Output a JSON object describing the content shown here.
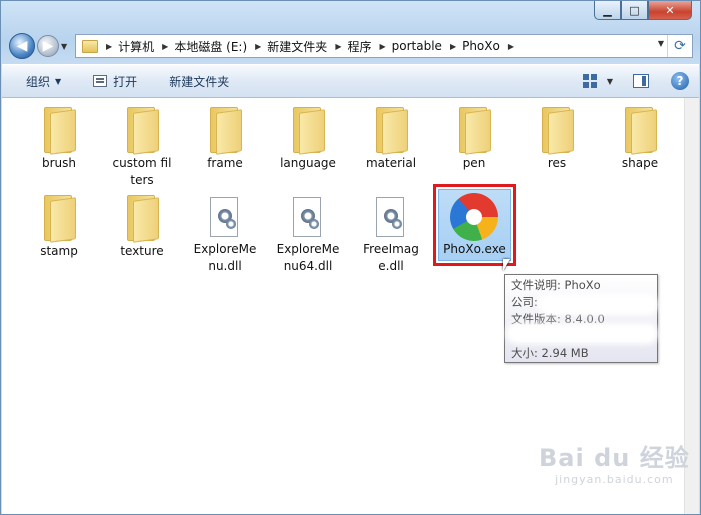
{
  "window": {
    "caption_buttons": [
      {
        "name": "minimize",
        "glyph": "▁"
      },
      {
        "name": "maximize",
        "glyph": "□"
      },
      {
        "name": "close",
        "glyph": "✕"
      }
    ]
  },
  "nav": {
    "back_glyph": "◀",
    "forward_glyph": "▶",
    "history_glyph": "▼"
  },
  "address": {
    "crumbs": [
      "计算机",
      "本地磁盘 (E:)",
      "新建文件夹",
      "程序",
      "portable",
      "PhoXo"
    ],
    "separator": "▶",
    "dropdown_glyph": "▼",
    "refresh_glyph": "⟳"
  },
  "toolbar": {
    "organize": "组织",
    "open": "打开",
    "new_folder": "新建文件夹",
    "dropdown_glyph": "▼",
    "help_glyph": "?"
  },
  "files": {
    "row1": [
      {
        "label": "brush"
      },
      {
        "label": "custom filters"
      },
      {
        "label": "frame"
      },
      {
        "label": "language"
      },
      {
        "label": "material"
      },
      {
        "label": "pen"
      },
      {
        "label": "res"
      },
      {
        "label": "shape"
      }
    ],
    "row2_folders": [
      {
        "label": "stamp"
      },
      {
        "label": "texture"
      }
    ],
    "row2_dlls": [
      {
        "label": "ExploreMenu.dll"
      },
      {
        "label": "ExploreMenu64.dll"
      },
      {
        "label": "FreeImage.dll"
      }
    ],
    "exe": {
      "label": "PhoXo.exe"
    }
  },
  "tooltip": {
    "description": "文件说明: PhoXo",
    "company": "公司:",
    "version": "文件版本: 8.4.0.0",
    "size": "大小: 2.94 MB"
  },
  "watermark": {
    "main": "Bai du 经验",
    "sub": "jingyan.baidu.com"
  },
  "colors": {
    "selection_highlight": "#e0191c",
    "titlebar": "#b8d3ee"
  }
}
